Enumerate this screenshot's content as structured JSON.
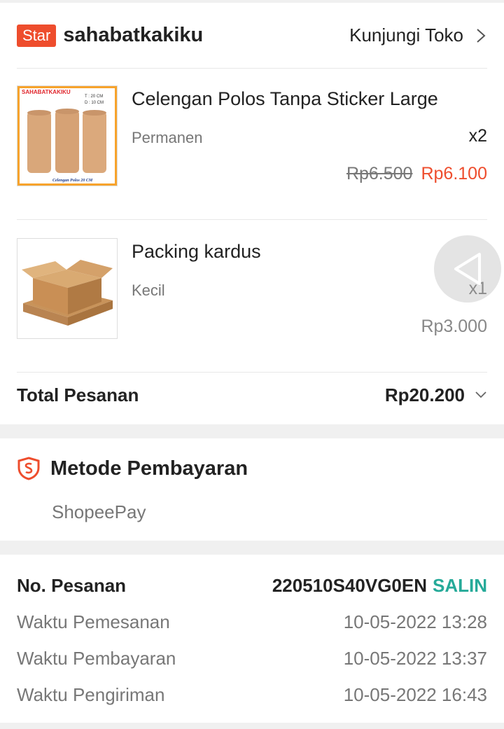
{
  "shop": {
    "badge": "Star",
    "name": "sahabatkakiku",
    "visit_label": "Kunjungi Toko",
    "visit_icon": "chevron-right-icon"
  },
  "products": [
    {
      "name": "Celengan Polos Tanpa Sticker Large",
      "variant": "Permanen",
      "quantity": "x2",
      "original_price": "Rp6.500",
      "price": "Rp6.100",
      "thumbnail": {
        "brand_text": "SAHABATKAKIKU",
        "dim_t": "T : 20 CM",
        "dim_d": "D : 10 CM",
        "caption": "Celengan Polos 20 CM"
      }
    },
    {
      "name": "Packing kardus",
      "variant": "Kecil",
      "quantity": "x1",
      "price": "Rp3.000"
    }
  ],
  "total": {
    "label": "Total Pesanan",
    "value": "Rp20.200",
    "icon": "chevron-down-icon"
  },
  "payment": {
    "icon": "shield-icon",
    "title": "Metode Pembayaran",
    "method": "ShopeePay"
  },
  "order_info": {
    "order_no_label": "No. Pesanan",
    "order_no": "220510S40VG0EN",
    "copy_label": "SALIN",
    "rows": [
      {
        "label": "Waktu Pemesanan",
        "value": "10-05-2022 13:28"
      },
      {
        "label": "Waktu Pembayaran",
        "value": "10-05-2022 13:37"
      },
      {
        "label": "Waktu Pengiriman",
        "value": "10-05-2022 16:43"
      }
    ]
  },
  "colors": {
    "accent": "#ee4d2d",
    "copy": "#26aa99",
    "muted": "#777777"
  }
}
